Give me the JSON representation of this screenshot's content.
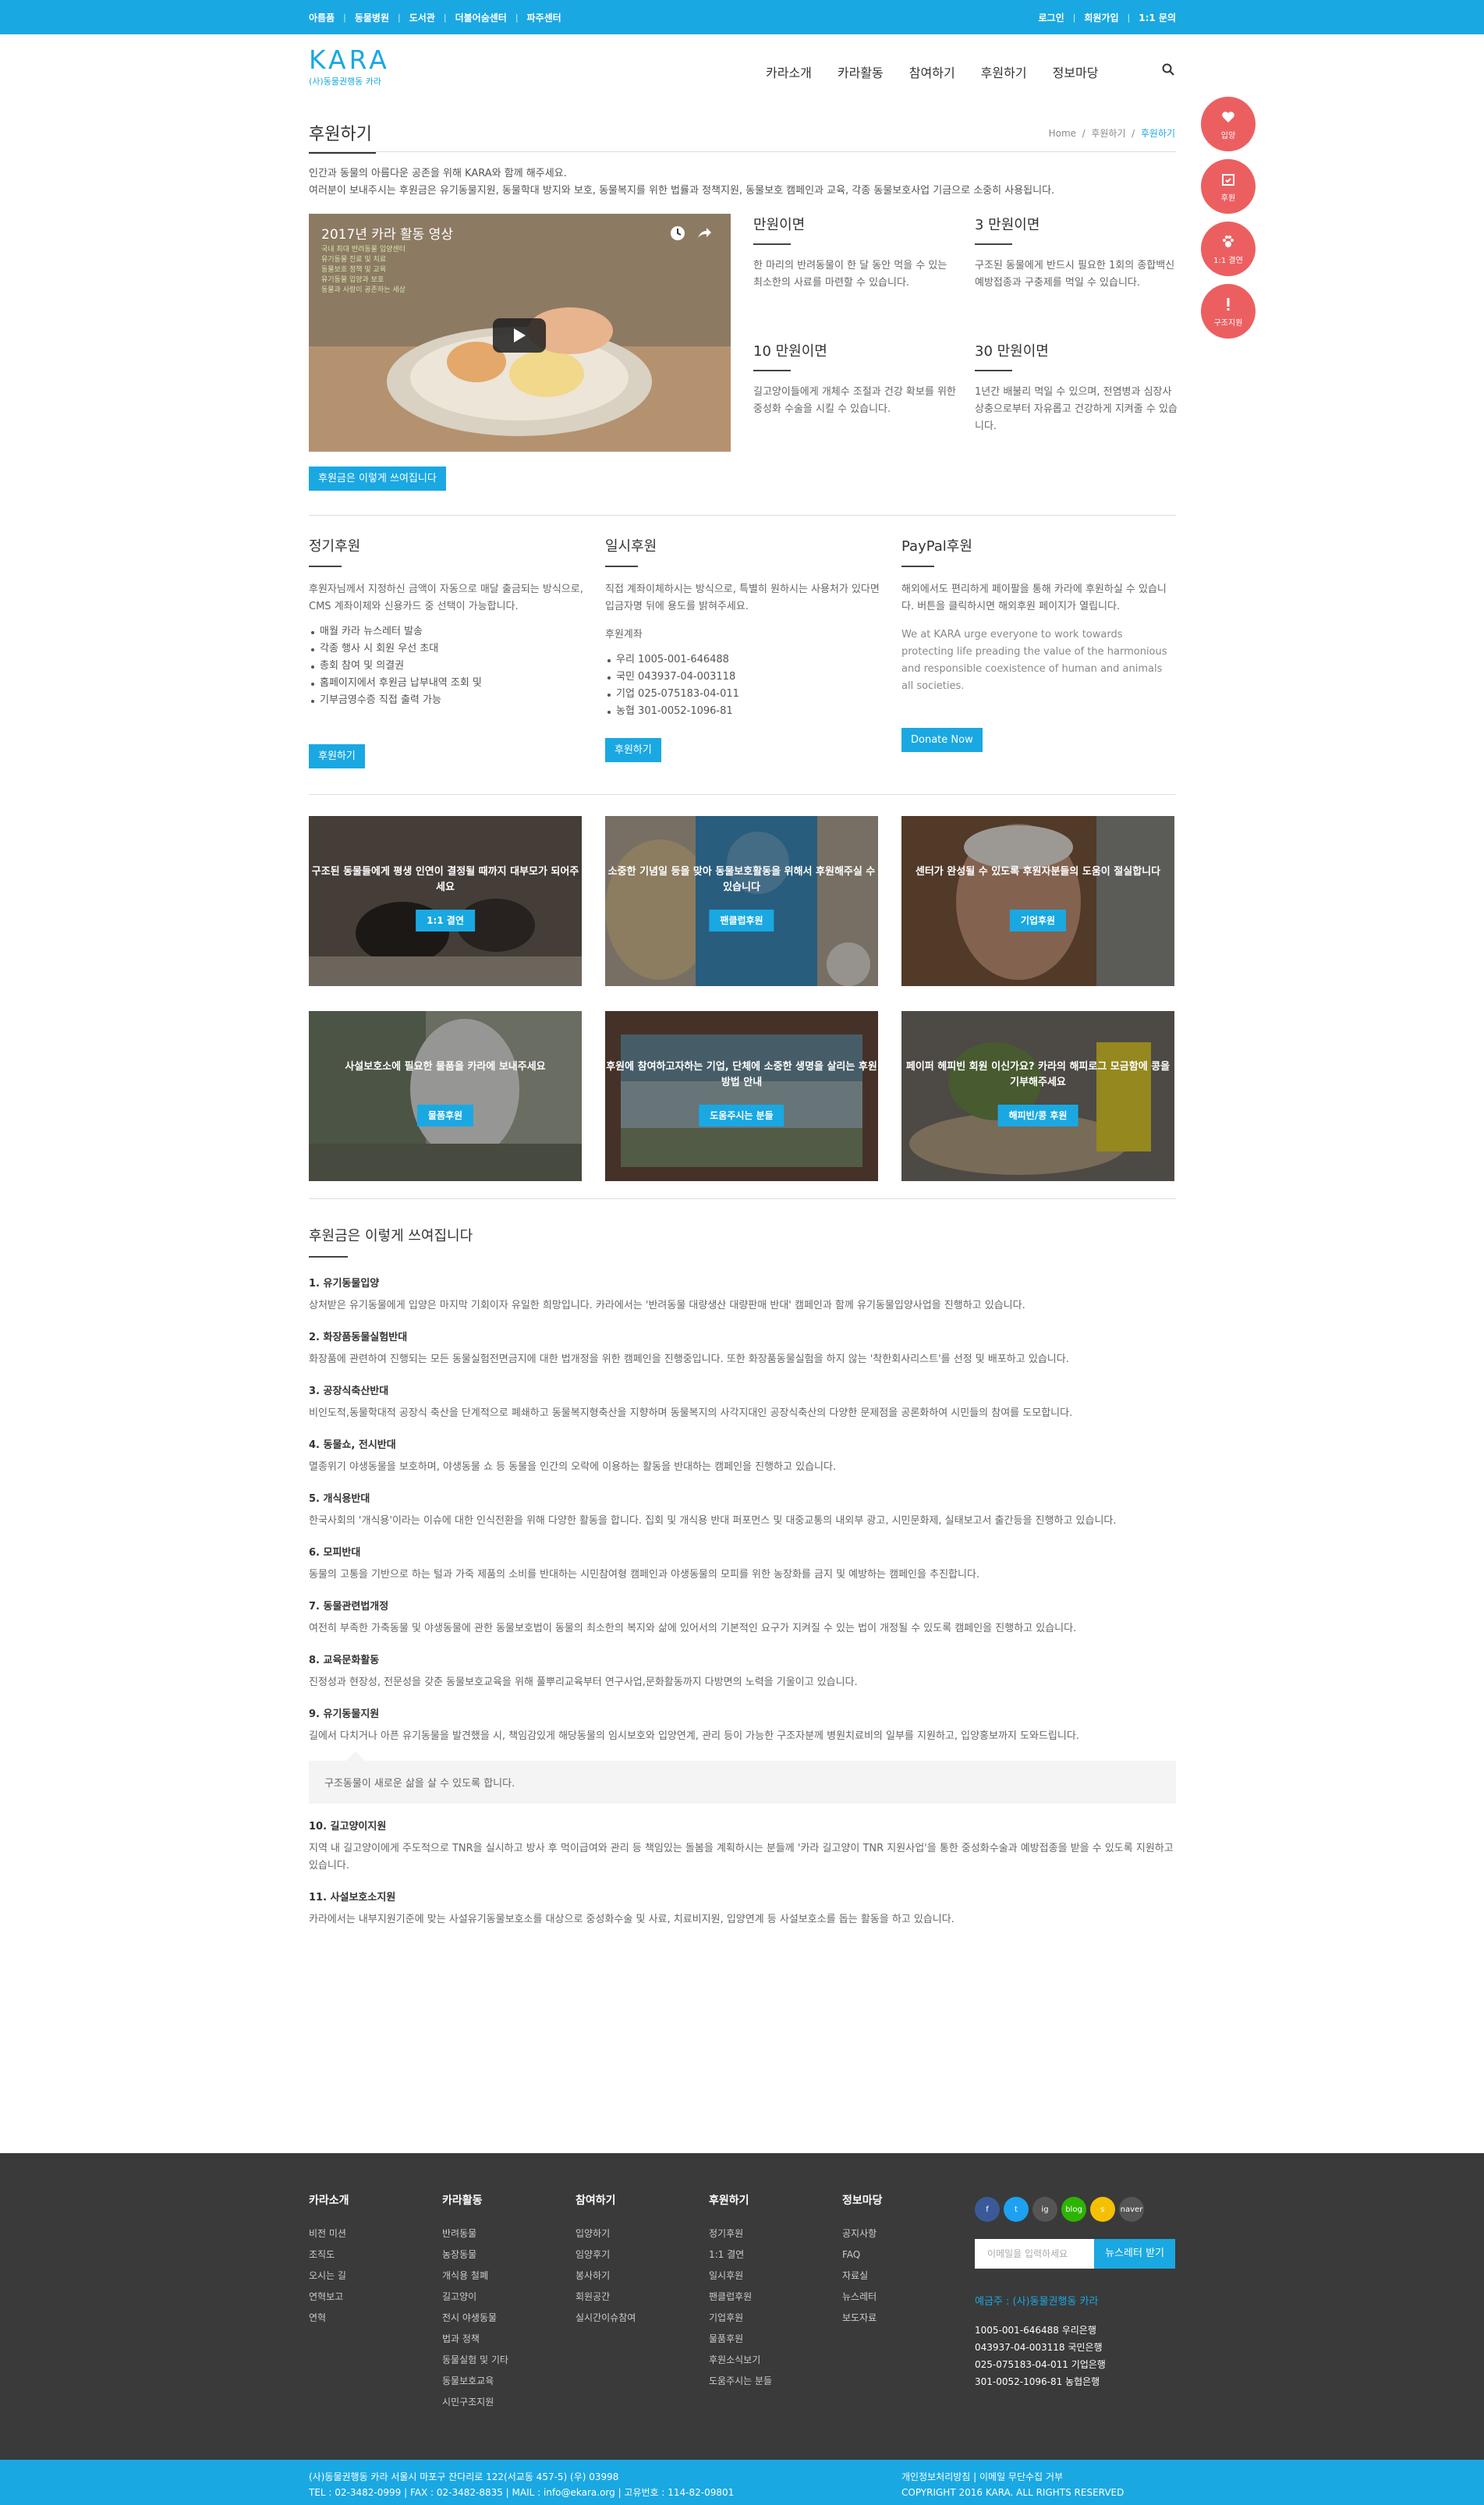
{
  "topbar": {
    "left": [
      "아름품",
      "동물병원",
      "도서관",
      "더불어숨센터",
      "파주센터"
    ],
    "right": [
      "로그인",
      "회원가입",
      "1:1 문의"
    ]
  },
  "logo": {
    "mark": "KARA",
    "sub": "(사)동물권행동 카라"
  },
  "nav": [
    "카라소개",
    "카라활동",
    "참여하기",
    "후원하기",
    "정보마당"
  ],
  "side": [
    "입양",
    "후원",
    "1:1 결연",
    "구조지원"
  ],
  "page": {
    "title": "후원하기",
    "crumb": [
      "Home",
      "후원하기",
      "후원하기"
    ]
  },
  "intro": [
    "인간과 동물의 아름다운 공존을 위해 KARA와 함께 해주세요.",
    "여러분이 보내주시는 후원금은 유기동물지원, 동물학대 방지와 보호, 동물복지를 위한 법률과 정책지원, 동물보호 캠페인과 교육, 각종 동물보호사업 기금으로 소중히 사용됩니다."
  ],
  "video": {
    "title": "2017년 카라 활동 영상",
    "overlay": [
      "국내 최대 반려동물 입양센터",
      "유기동물 진료 및 치료",
      "동물보호 정책 및 교육",
      "유기동물 입양과 보호",
      "동물과 사람이 공존하는 세상"
    ]
  },
  "video_button": "후원금은 이렇게 쓰여집니다",
  "amounts": [
    {
      "h": "만원이면",
      "t": "한 마리의 반려동물이 한 달 동안 먹을 수 있는 최소한의 사료를 마련할 수 있습니다."
    },
    {
      "h": "3 만원이면",
      "t": "구조된 동물에게 반드시 필요한 1회의 종합백신 예방접종과 구충제를 먹일 수 있습니다."
    },
    {
      "h": "10 만원이면",
      "t": "길고양이들에게 개체수 조절과 건강 확보를 위한 중성화 수술을 시킬 수 있습니다."
    },
    {
      "h": "30 만원이면",
      "t": "1년간 배불리 먹일 수 있으며, 전염병과 심장사상충으로부터 자유롭고 건강하게 지켜줄 수 있습니다."
    }
  ],
  "regular": {
    "h": "정기후원",
    "t": "후원자님께서 지정하신 금액이 자동으로 매달 출금되는 방식으로, CMS 계좌이체와 신용카드 중 선택이 가능합니다.",
    "list": [
      "매월 카라 뉴스레터 발송",
      "각종 행사 시 회원 우선 초대",
      "총회 참여 및 의결권",
      "홈페이지에서 후원금 납부내역 조회 및",
      "기부금영수증 직접 출력 가능"
    ],
    "btn": "후원하기"
  },
  "once": {
    "h": "일시후원",
    "t": "직접 계좌이체하시는 방식으로, 특별히 원하시는 사용처가 있다면 입금자명 뒤에 용도를 밝혀주세요.",
    "label": "후원계좌",
    "list": [
      "우리 1005-001-646488",
      "국민 043937-04-003118",
      "기업 025-075183-04-011",
      "농협 301-0052-1096-81"
    ],
    "btn": "후원하기"
  },
  "paypal": {
    "h": "PayPal후원",
    "t": "해외에서도 편리하게 페이팔을 통해 카라에 후원하실 수 있습니다. 버튼을 클릭하시면 해외후원 페이지가 열립니다.",
    "t2": "We at KARA urge everyone to work towards protecting life preading the value of the harmonious and responsible coexistence of human and animals all societies.",
    "btn": "Donate Now"
  },
  "cards": [
    {
      "t": "구조된 동물들에게 평생 인연이 결정될 때까지 대부모가 되어주세요",
      "b": "1:1 결연",
      "c": "#5b5048"
    },
    {
      "t": "소중한 기념일 등을 맞아 동물보호활동을 위해서 후원해주실 수 있습니다",
      "b": "팬클럽후원",
      "c": "#8a7a66"
    },
    {
      "t": "센터가 완성될 수 있도록 후원자분들의 도움이 절실합니다",
      "b": "기업후원",
      "c": "#76604a"
    },
    {
      "t": "사설보호소에 필요한 물품을 카라에 보내주세요",
      "b": "물품후원",
      "c": "#8c8f7c"
    },
    {
      "t": "후원에 참여하고자하는 기업, 단체에 소중한 생명을 살리는 후원방법 안내",
      "b": "도움주시는 분들",
      "c": "#6b5e56"
    },
    {
      "t": "페이퍼 헤피빈 회원 이신가요? 카라의 해피로그 모금함에 콩을 기부해주세요",
      "b": "해피빈/콩 후원",
      "c": "#7a7058"
    }
  ],
  "usage": {
    "h": "후원금은 이렇게 쓰여집니다",
    "items": [
      {
        "q": "1. 유기동물입양",
        "a": "상처받은 유기동물에게 입양은 마지막 기회이자 유일한 희망입니다. 카라에서는 '반려동물 대량생산 대량판매 반대' 캠페인과 함께 유기동물입양사업을 진행하고 있습니다."
      },
      {
        "q": "2. 화장품동물실험반대",
        "a": "화장품에 관련하여 진행되는 모든 동물실험전면금지에 대한 법개정을 위한 캠페인을 진행중입니다. 또한 화장품동물실험을 하지 않는 '착한회사리스트'를 선정 및 배포하고 있습니다."
      },
      {
        "q": "3. 공장식축산반대",
        "a": "비인도적,동물학대적 공장식 축산을 단계적으로 폐쇄하고 동물복지형축산을 지향하며 동물복지의 사각지대인 공장식축산의 다양한 문제점을 공론화하여 시민들의 참여를 도모합니다."
      },
      {
        "q": "4. 동물쇼, 전시반대",
        "a": "멸종위기 야생동물을 보호하며, 야생동물 쇼 등 동물을 인간의 오락에 이용하는 활동을 반대하는 캠페인을 진행하고 있습니다."
      },
      {
        "q": "5. 개식용반대",
        "a": "한국사회의 '개식용'이라는 이슈에 대한 인식전환을 위해 다양한 활동을 합니다. 집회 및 개식용 반대 퍼포먼스 및 대중교통의 내외부 광고, 시민문화제, 실태보고서 출간등을 진행하고 있습니다."
      },
      {
        "q": "6. 모피반대",
        "a": "동물의 고통을 기반으로 하는 털과 가죽 제품의 소비를 반대하는 시민참여형 캠페인과 야생동물의 모피를 위한 농장화를 금지 및 예방하는 캠페인을 추진합니다."
      },
      {
        "q": "7. 동물관련법개정",
        "a": "여전히 부족한 가축동물 및 야생동물에 관한 동물보호법이 동물의 최소한의 복지와 삶에 있어서의 기본적인 요구가 지켜질 수 있는 법이 개정될 수 있도록 캠페인을 진행하고 있습니다."
      },
      {
        "q": "8. 교육문화활동",
        "a": "진정성과 현장성, 전문성을 갖춘 동물보호교육을 위해 풀뿌리교육부터 연구사업,문화활동까지 다방면의 노력을 기울이고 있습니다."
      },
      {
        "q": "9. 유기동물지원",
        "a": "길에서 다치거나 아픈 유기동물을 발견했을 시, 책임감있게 해당동물의 임시보호와 입양연계, 관리 등이 가능한 구조자분께 병원치료비의 일부를 지원하고, 입양홍보까지 도와드립니다.",
        "quote": "구조동물이 새로운 삶을 살 수 있도록 합니다."
      },
      {
        "q": "10. 길고양이지원",
        "a": "지역 내 길고양이에게 주도적으로 TNR을 실시하고 방사 후 먹이급여와 관리 등 책임있는 돌봄을 계획하시는 분들께 '카라 길고양이 TNR 지원사업'을 통한 중성화수술과 예방접종을 받을 수 있도록 지원하고 있습니다."
      },
      {
        "q": "11. 사설보호소지원",
        "a": "카라에서는 내부지원기준에 맞는 사설유기동물보호소를 대상으로 중성화수술 및 사료, 치료비지원, 입양연계 등 사설보호소를 돕는 활동을 하고 있습니다."
      }
    ]
  },
  "footer": {
    "cols": [
      {
        "h": "카라소개",
        "i": [
          "비전 미션",
          "조직도",
          "오시는 길",
          "연혁보고",
          "연혁"
        ]
      },
      {
        "h": "카라활동",
        "i": [
          "반려동물",
          "농장동물",
          "개식용 철폐",
          "길고양이",
          "전시 야생동물",
          "법과 정책",
          "동물실험 및 기타",
          "동물보호교육",
          "시민구조지원"
        ]
      },
      {
        "h": "참여하기",
        "i": [
          "입양하기",
          "임양후기",
          "봉사하기",
          "회원공간",
          "실시간이슈참여"
        ]
      },
      {
        "h": "후원하기",
        "i": [
          "정기후원",
          "1:1 결연",
          "일시후원",
          "팬클럽후원",
          "기업후원",
          "물품후원",
          "후원소식보기",
          "도움주시는 분들"
        ]
      },
      {
        "h": "정보마당",
        "i": [
          "공지사항",
          "FAQ",
          "자료실",
          "뉴스레터",
          "보도자료"
        ]
      }
    ],
    "sns": [
      "f",
      "t",
      "ig",
      "blog",
      "s",
      "naver"
    ],
    "nl_placeholder": "이메일을 입력하세요",
    "nl_btn": "뉴스레터 받기",
    "acct_title": "예금주 : (사)동물권행동 카라",
    "acct": [
      "1005-001-646488 우리은행",
      "043937-04-003118 국민은행",
      "025-075183-04-011 기업은행",
      "301-0052-1096-81 농협은행"
    ]
  },
  "bottom": {
    "l1": "(사)동물권행동 카라    서울시 마포구 잔다리로 122(서교동 457-5) (우) 03998",
    "l2": "TEL : 02-3482-0999  |  FAX : 02-3482-8835  |  MAIL : info@ekara.org  |  고유번호 : 114-82-09801",
    "r1": "개인정보처리방침    |  이메일 무단수집 거부",
    "r2": "COPYRIGHT 2016 KARA. ALL RIGHTS RESERVED"
  },
  "colors": {
    "primary": "#1aa8e2",
    "side": "#ec5f61",
    "footer": "#3a3a3a"
  }
}
